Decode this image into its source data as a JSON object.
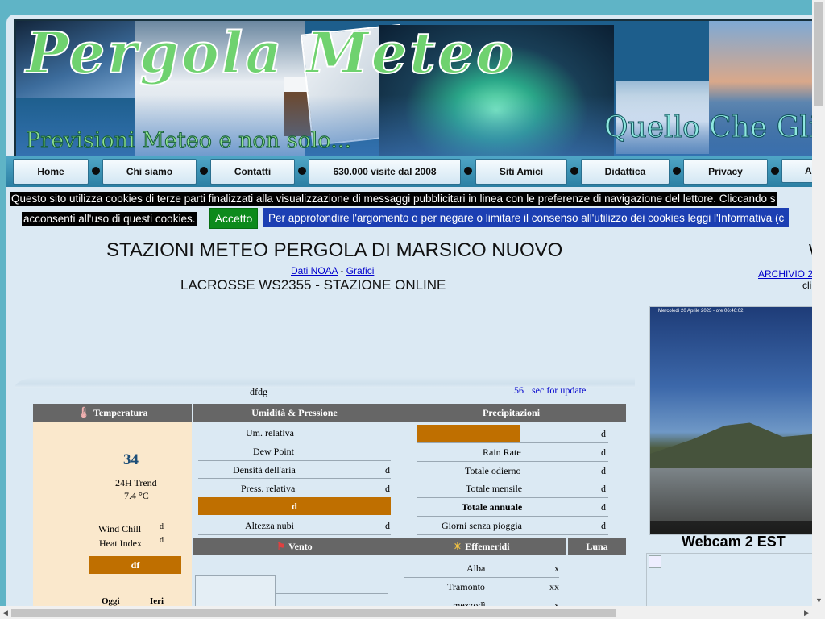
{
  "header": {
    "logo": "Pergola Meteo",
    "tagline": "Previsioni Meteo e non solo...",
    "tagline_right": "Quello Che Gli A"
  },
  "nav": {
    "items": [
      "Home",
      "Chi siamo",
      "Contatti",
      "630.000 visite dal 2008",
      "Siti Amici",
      "Didattica",
      "Privacy",
      "A"
    ]
  },
  "cookie": {
    "line1": "Questo sito utilizza cookies di terze parti finalizzati alla visualizzazione di messaggi pubblicitari in linea con le preferenze di navigazione del lettore. Cliccando s",
    "line2": "acconsenti all'uso di questi cookies.",
    "accept": "Accetto",
    "info": "Per approfondire l'argomento o per negare o limitare il consenso all'utilizzo dei cookies leggi l'Informativa (c"
  },
  "main": {
    "title": "STAZIONI METEO PERGOLA DI MARSICO NUOVO",
    "link_noaa": "Dati NOAA",
    "link_sep": " - ",
    "link_charts": "Grafici",
    "station": "LACROSSE WS2355 - STAZIONE ONLINE",
    "right_head": "W",
    "archive": "ARCHIVIO 2",
    "cli": "cli"
  },
  "status": {
    "dfdg": "dfdg",
    "seconds": "56",
    "sec_label": "sec for update"
  },
  "temperature": {
    "header": "Temperatura",
    "value": "34",
    "trend_label": "24H Trend",
    "trend_value": "7.4 °C",
    "wind_chill_label": "Wind Chill",
    "wind_chill_value": "d",
    "heat_index_label": "Heat Index",
    "heat_index_value": "d",
    "bar": "df",
    "today": "Oggi",
    "yesterday": "Ieri"
  },
  "humidity": {
    "header": "Umidità & Pressione",
    "rows": [
      {
        "label": "Um. relativa",
        "value": ""
      },
      {
        "label": "Dew Point",
        "value": ""
      },
      {
        "label": "Densità dell'aria",
        "value": "d"
      },
      {
        "label": "Press. relativa",
        "value": "d"
      }
    ],
    "bar": "d",
    "cloud_label": "Altezza nubi",
    "cloud_value": "d"
  },
  "precipitation": {
    "header": "Precipitazioni",
    "top_value": "d",
    "rows": [
      {
        "label": "Rain Rate",
        "value": "d"
      },
      {
        "label": "Totale odierno",
        "value": "d"
      },
      {
        "label": "Totale mensile",
        "value": "d"
      },
      {
        "label": "Totale annuale",
        "value": "d"
      },
      {
        "label": "Giorni senza pioggia",
        "value": "d"
      }
    ]
  },
  "wind": {
    "header": "Vento"
  },
  "ephemeris": {
    "header": "Effemeridi",
    "rows": [
      {
        "label": "Alba",
        "value": "x"
      },
      {
        "label": "Tramonto",
        "value": "xx"
      },
      {
        "label": "mezzodì",
        "value": "x"
      }
    ]
  },
  "moon": {
    "header": "Luna"
  },
  "webcam": {
    "caption": "Mercoledì 20 Aprile 2023 - ore 06:46:02",
    "label": "Webcam 2  EST"
  },
  "colors": {
    "header_gray": "#666666",
    "orange": "#bf6f00",
    "temp_panel": "#fae8cc",
    "accept_green": "#0d8a1c",
    "info_blue": "#1c3fb3"
  }
}
